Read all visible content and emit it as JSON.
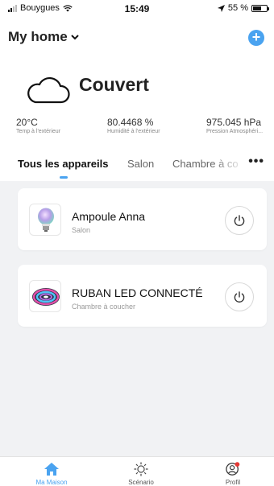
{
  "status_bar": {
    "carrier": "Bouygues",
    "time": "15:49",
    "battery": "55 %"
  },
  "header": {
    "home_name": "My home",
    "add_icon": "plus-icon"
  },
  "weather": {
    "condition": "Couvert",
    "temperature": "20°C",
    "temperature_label": "Temp à l'extérieur",
    "humidity": "80.4468 %",
    "humidity_label": "Humidité à l'extérieur",
    "pressure": "975.045 hPa",
    "pressure_label": "Pression Atmosphéri..."
  },
  "tabs": {
    "items": [
      {
        "label": "Tous les appareils"
      },
      {
        "label": "Salon"
      },
      {
        "label": "Chambre à co"
      }
    ],
    "active_index": 0,
    "more": "•••"
  },
  "devices": [
    {
      "name": "Ampoule Anna",
      "room": "Salon",
      "icon": "bulb-icon"
    },
    {
      "name": "RUBAN LED CONNECTÉ",
      "room": "Chambre à coucher",
      "icon": "led-strip-icon"
    }
  ],
  "bottom_nav": [
    {
      "label": "Ma Maison",
      "icon": "home-icon"
    },
    {
      "label": "Scénario",
      "icon": "sun-icon"
    },
    {
      "label": "Profil",
      "icon": "profile-icon"
    }
  ],
  "colors": {
    "accent": "#4aa3f0",
    "notification": "#e53935"
  }
}
